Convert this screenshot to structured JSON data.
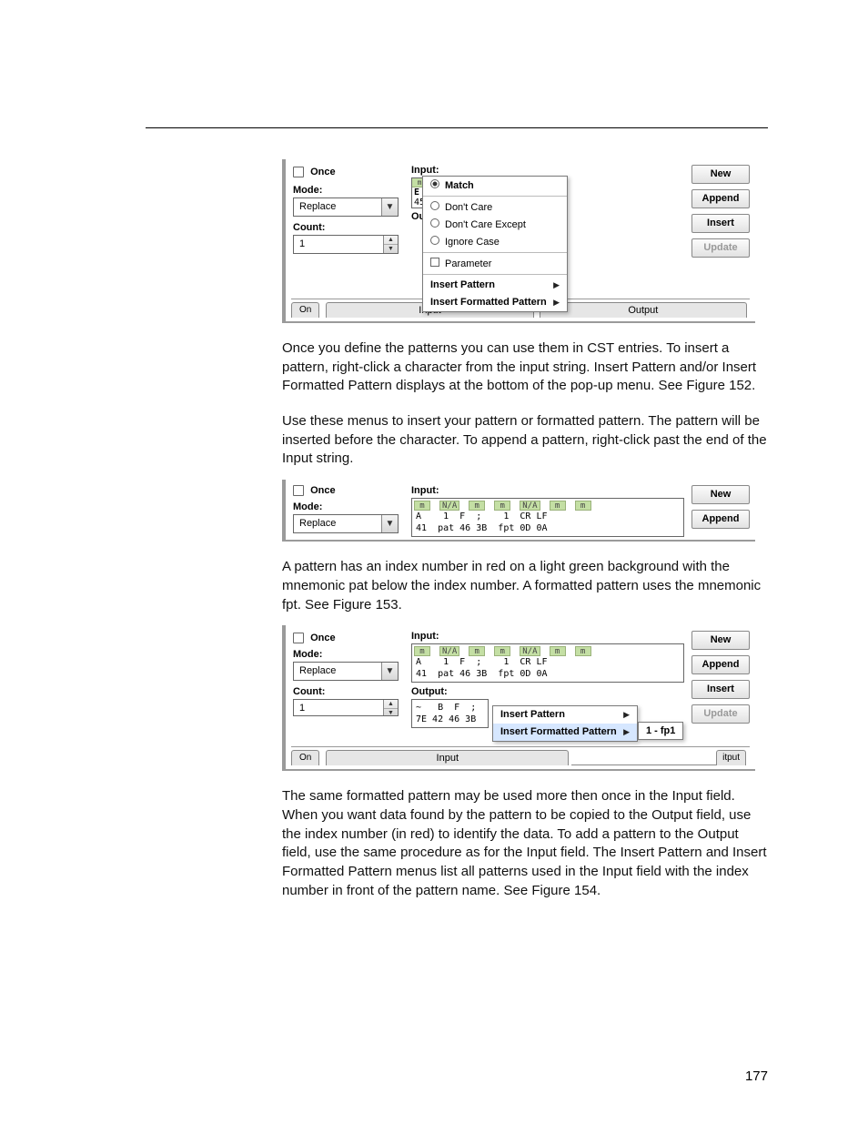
{
  "paragraphs": {
    "p1": "Once you define the patterns you can use them in CST entries. To insert a pattern, right-click a character from the input string. Insert Pattern and/or Insert Formatted Pattern displays at the bottom of the pop-up menu. See Figure 152.",
    "p2": "Use these menus to insert your pattern or formatted pattern. The pattern will be inserted before the character. To append a pattern, right-click past the end of the Input string.",
    "p3a": "A pattern has an index number in red on a light green background with the mnemonic ",
    "p3b": " below the index number. A formatted pattern uses the mnemonic ",
    "p3c": ". See Figure 153.",
    "mn1": "pat",
    "mn2": "fpt",
    "p4": "The same formatted pattern may be used more then once in the Input field. When you want data found by the pattern to be copied to the Output field, use the index number (in red) to identify the data. To add a pattern to the Output field, use the same procedure as for the Input field. The Insert Pattern and Insert Formatted Pattern menus list all patterns used in the Input field with the index number in front of the pattern name. See Figure 154."
  },
  "common": {
    "once": "Once",
    "mode": "Mode:",
    "replace": "Replace",
    "count": "Count:",
    "countVal": "1",
    "input": "Input:",
    "output": "Output:",
    "on": "On",
    "inputTab": "Input",
    "outputTab": "Output",
    "new": "New",
    "append": "Append",
    "insert": "Insert",
    "update": "Update"
  },
  "menu1": {
    "match": "Match",
    "dontcare": "Don't Care",
    "dontcareexcept": "Don't Care Except",
    "ignorecase": "Ignore Case",
    "parameter": "Parameter",
    "insertpattern": "Insert Pattern",
    "insertfpattern": "Insert Formatted Pattern"
  },
  "fig1": {
    "trunc1": "E",
    "trunc2": "45",
    "trunc3": "Ou",
    "boxtop": "m"
  },
  "fig2": {
    "green": {
      "c0": "m",
      "c1": "N/A",
      "c2": "m",
      "c3": "m",
      "c4": "N/A",
      "c5": "m",
      "c6": "m"
    },
    "row1": "A    1  F  ;    1  CR LF",
    "row2": "41  pat 46 3B  fpt 0D 0A"
  },
  "fig3": {
    "green": {
      "c0": "m",
      "c1": "N/A",
      "c2": "m",
      "c3": "m",
      "c4": "N/A",
      "c5": "m",
      "c6": "m"
    },
    "row1": "A    1  F  ;    1  CR LF",
    "row2": "41  pat 46 3B  fpt 0D 0A",
    "out1": "~   B  F  ;",
    "out2": "7E 42 46 3B",
    "menuInsert": "Insert Pattern",
    "menuInsertF": "Insert Formatted Pattern",
    "sub": "1 - fp1",
    "itputTab": "itput"
  },
  "pageNumber": "177"
}
